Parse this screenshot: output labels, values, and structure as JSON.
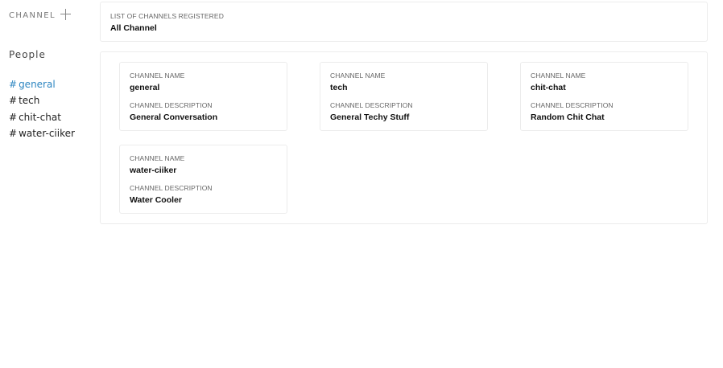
{
  "sidebar": {
    "channel_header": "CHANNEL",
    "people_label": "People",
    "channels": [
      {
        "hash": "#",
        "name": "general"
      },
      {
        "hash": "#",
        "name": "tech"
      },
      {
        "hash": "#",
        "name": "chit-chat"
      },
      {
        "hash": "#",
        "name": "water-ciiker"
      }
    ]
  },
  "header_panel": {
    "label": "LIST OF CHANNELS REGISTERED",
    "value": "All Channel"
  },
  "card_labels": {
    "name": "CHANNEL NAME",
    "description": "CHANNEL DESCRIPTION"
  },
  "cards": [
    {
      "name": "general",
      "description": "General Conversation"
    },
    {
      "name": "tech",
      "description": "General Techy Stuff"
    },
    {
      "name": "chit-chat",
      "description": "Random Chit Chat"
    },
    {
      "name": "water-ciiker",
      "description": "Water Cooler"
    }
  ],
  "colors": {
    "active_link": "#2e86c1",
    "border": "#ececec"
  }
}
